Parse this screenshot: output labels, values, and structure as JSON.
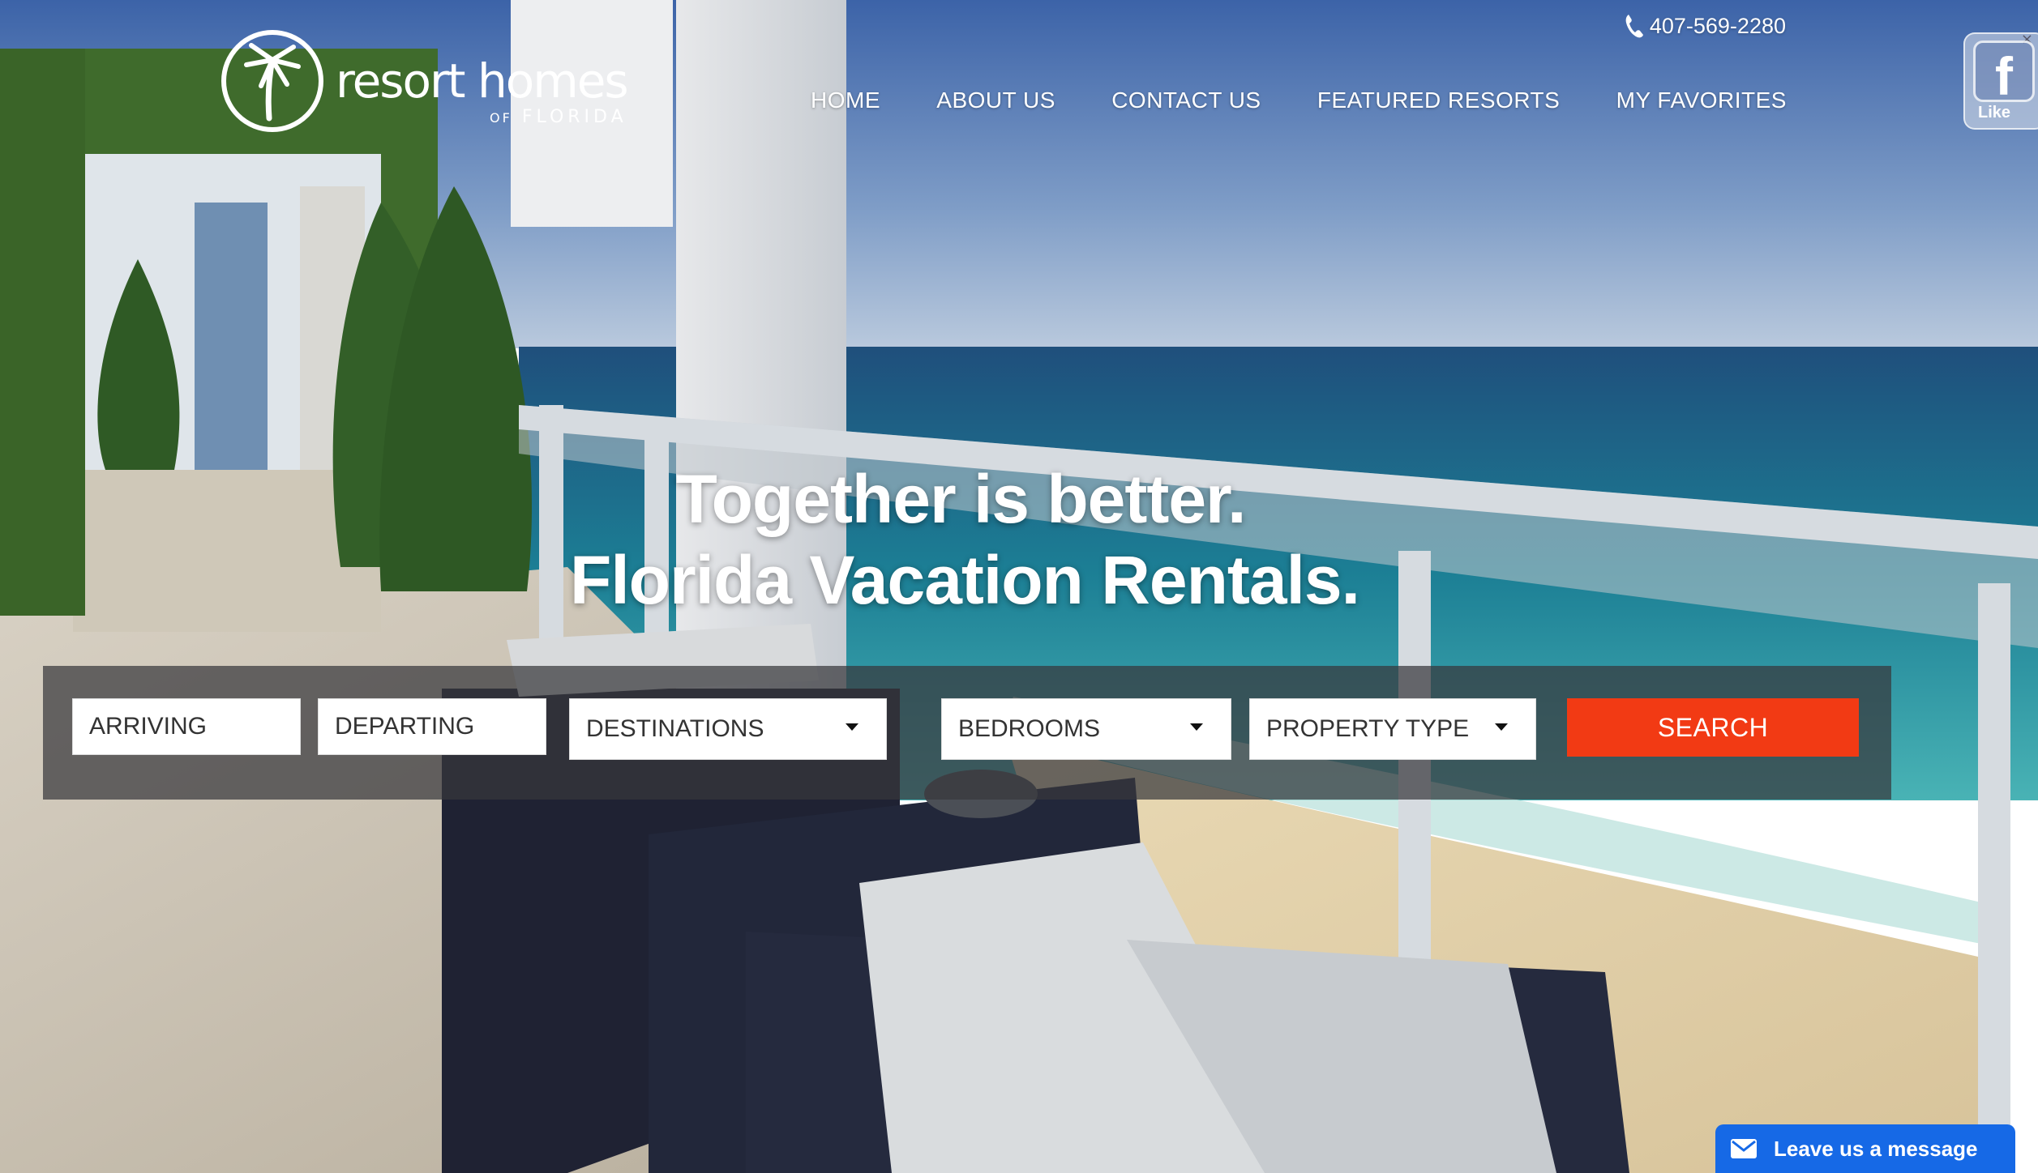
{
  "brand": {
    "logo_main": "resort homes",
    "logo_sub_prefix": "OF",
    "logo_sub": "FLORIDA"
  },
  "header": {
    "phone": "407-569-2280"
  },
  "nav": {
    "items": [
      {
        "label": "HOME"
      },
      {
        "label": "ABOUT US"
      },
      {
        "label": "CONTACT US"
      },
      {
        "label": "FEATURED RESORTS"
      },
      {
        "label": "MY FAVORITES"
      }
    ]
  },
  "facebook": {
    "glyph": "f",
    "like_label": "Like",
    "close_glyph": "×"
  },
  "hero": {
    "headline_line1": "Together is better.",
    "headline_line2": "Florida Vacation Rentals."
  },
  "search": {
    "arriving_placeholder": "ARRIVING",
    "departing_placeholder": "DEPARTING",
    "destinations_label": "DESTINATIONS",
    "bedrooms_label": "BEDROOMS",
    "property_type_label": "PROPERTY TYPE",
    "search_button": "SEARCH"
  },
  "chat": {
    "label": "Leave us a message"
  },
  "colors": {
    "accent": "#f23a14",
    "chat": "#1669e6",
    "overlay": "#37373c"
  }
}
